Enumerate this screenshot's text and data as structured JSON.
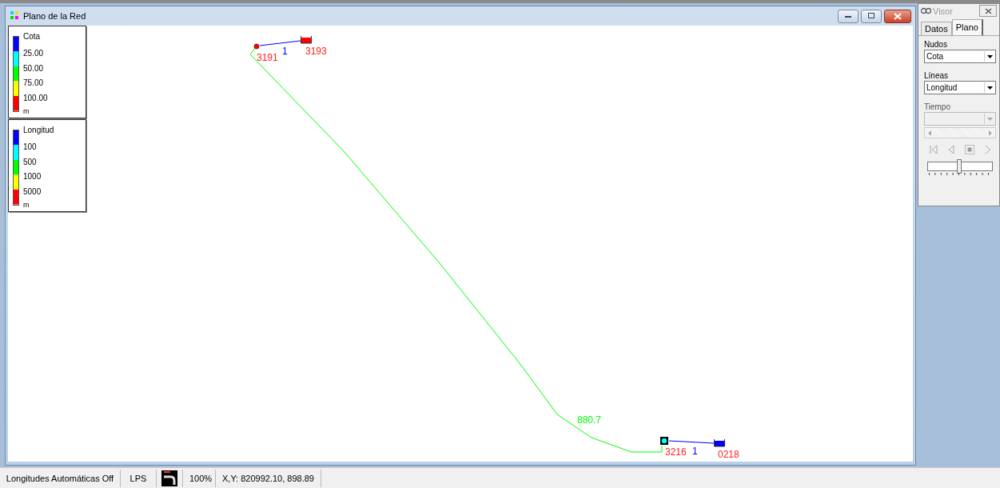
{
  "map_window": {
    "title": "Plano de la Red"
  },
  "legends": [
    {
      "title": "Cota",
      "bands": [
        {
          "color": "#0000ff"
        },
        {
          "color": "#00ffff"
        },
        {
          "color": "#00ff00"
        },
        {
          "color": "#ffff00"
        },
        {
          "color": "#ff0000"
        }
      ],
      "labels": [
        "25.00",
        "50.00",
        "75.00",
        "100.00"
      ],
      "units": "m"
    },
    {
      "title": "Longitud",
      "bands": [
        {
          "color": "#0000ff"
        },
        {
          "color": "#00ffff"
        },
        {
          "color": "#00ff00"
        },
        {
          "color": "#ffff00"
        },
        {
          "color": "#ff0000"
        }
      ],
      "labels": [
        "100",
        "500",
        "1000",
        "5000"
      ],
      "units": "m"
    }
  ],
  "nodes": [
    {
      "kind": "junction",
      "label": "3191",
      "color": "#ff0000"
    },
    {
      "kind": "tank",
      "label": "3193",
      "color": "#ff0000"
    },
    {
      "kind": "reservoir",
      "label": "3216",
      "color": "#00ffff"
    },
    {
      "kind": "tank",
      "label": "0218",
      "color": "#0000ff"
    }
  ],
  "links": [
    {
      "label": "1",
      "color": "#0000ff"
    },
    {
      "label": "880.7",
      "color": "#00ff00"
    },
    {
      "label": "1",
      "color": "#0000ff"
    }
  ],
  "browser": {
    "title": "Visor",
    "tabs": [
      {
        "label": "Datos",
        "selected": false
      },
      {
        "label": "Plano",
        "selected": true
      }
    ],
    "fields": [
      {
        "label": "Nudos",
        "value": "Cota",
        "disabled": false
      },
      {
        "label": "Líneas",
        "value": "Longitud",
        "disabled": false
      },
      {
        "label": "Tiempo",
        "disabled": true
      }
    ],
    "speed": {
      "level": 0.5
    }
  },
  "status_bar": {
    "auto_length": "Longitudes Automáticas Off",
    "units": "LPS",
    "zoom": "100%",
    "coords": "X,Y: 820992.10, 898.89"
  }
}
